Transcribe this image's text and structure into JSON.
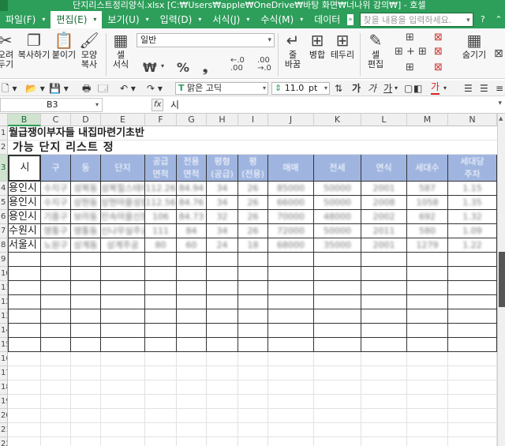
{
  "window": {
    "title": "단지리스트정리양식.xlsx [C:₩Users₩apple₩OneDrive₩바탕 화면₩너나위 강의₩] - 호셀"
  },
  "menu": {
    "items": [
      {
        "label": "파일(F)",
        "active": false
      },
      {
        "label": "편집(E)",
        "active": true
      },
      {
        "label": "보기(U)",
        "active": false
      },
      {
        "label": "입력(D)",
        "active": false
      },
      {
        "label": "서식(J)",
        "active": false
      },
      {
        "label": "수식(M)",
        "active": false
      },
      {
        "label": "데이터",
        "active": false
      }
    ],
    "search_placeholder": "찾을 내용을 입력하세요."
  },
  "ribbon": {
    "cut_label": "오려\n두기",
    "copy_label": "복사하기",
    "paste_label": "붙이기",
    "format_copy_label": "모양\n복사",
    "cell_style_label": "셀\n서식",
    "number_format": "일반",
    "currency_symbol": "₩",
    "percent_symbol": "%",
    "comma_symbol": "❟",
    "wrap_label": "줄\n바꿈",
    "merge_label": "병합",
    "border_label": "테두리",
    "cell_edit_label": "셀\n편집",
    "hide_label": "숨기기"
  },
  "format_toolbar": {
    "font_name": "맑은 고딕",
    "font_size": "11.0",
    "font_unit": "pt",
    "bold": "가",
    "italic": "가",
    "underline": "가",
    "font_color": "가"
  },
  "formula_bar": {
    "cell_ref": "B3",
    "fx_label": "fx",
    "content": "시"
  },
  "sheet": {
    "columns": [
      "B",
      "C",
      "D",
      "E",
      "F",
      "G",
      "H",
      "I",
      "J",
      "K",
      "L",
      "M",
      "N"
    ],
    "selected_column": "B",
    "row_numbers": [
      "1",
      "2",
      "3",
      "4",
      "5",
      "6",
      "7",
      "8",
      "9",
      "10",
      "11",
      "12",
      "13",
      "14",
      "15",
      "16",
      "17",
      "18",
      "19",
      "20",
      "21",
      "22",
      "23"
    ],
    "selected_row": "3",
    "title_row1": "월급쟁이부자들 내집마련기초반",
    "title_row2": "가능 단지 리스트 정",
    "header": {
      "city": "시",
      "c": "구",
      "d": "동",
      "e": "단지",
      "f": "공급\n면적",
      "g": "전용\n면적",
      "h": "평형\n(공급)",
      "i": "평\n(전용)",
      "j": "매매",
      "k": "전세",
      "l": "연식",
      "m": "세대수",
      "n": "세대당\n주차"
    },
    "rows": [
      {
        "city": "용인시",
        "c": "수지구",
        "d": "성복동",
        "e": "성복힐스테이트",
        "f": "112.26",
        "g": "84.94",
        "h": "34",
        "i": "26",
        "j": "85000",
        "k": "50000",
        "l": "2001",
        "m": "587",
        "n": "1.15"
      },
      {
        "city": "용인시",
        "c": "수지구",
        "d": "상현동",
        "e": "상현마을성원",
        "f": "112.56",
        "g": "84.76",
        "h": "34",
        "i": "26",
        "j": "66000",
        "k": "50000",
        "l": "2008",
        "m": "1058",
        "n": "1.35"
      },
      {
        "city": "용인시",
        "c": "기흥구",
        "d": "보라동",
        "e": "민속마을신창",
        "f": "106",
        "g": "84.73",
        "h": "32",
        "i": "26",
        "j": "70000",
        "k": "48000",
        "l": "2002",
        "m": "692",
        "n": "1.32"
      },
      {
        "city": "수원시",
        "c": "영통구",
        "d": "영통동",
        "e": "신나무실주공",
        "f": "111",
        "g": "84",
        "h": "34",
        "i": "26",
        "j": "72000",
        "k": "50000",
        "l": "2011",
        "m": "580",
        "n": "1.09"
      },
      {
        "city": "서울시",
        "c": "노원구",
        "d": "상계동",
        "e": "상계주공",
        "f": "80",
        "g": "60",
        "h": "24",
        "i": "18",
        "j": "68000",
        "k": "35000",
        "l": "2001",
        "m": "1279",
        "n": "1.22"
      }
    ]
  }
}
